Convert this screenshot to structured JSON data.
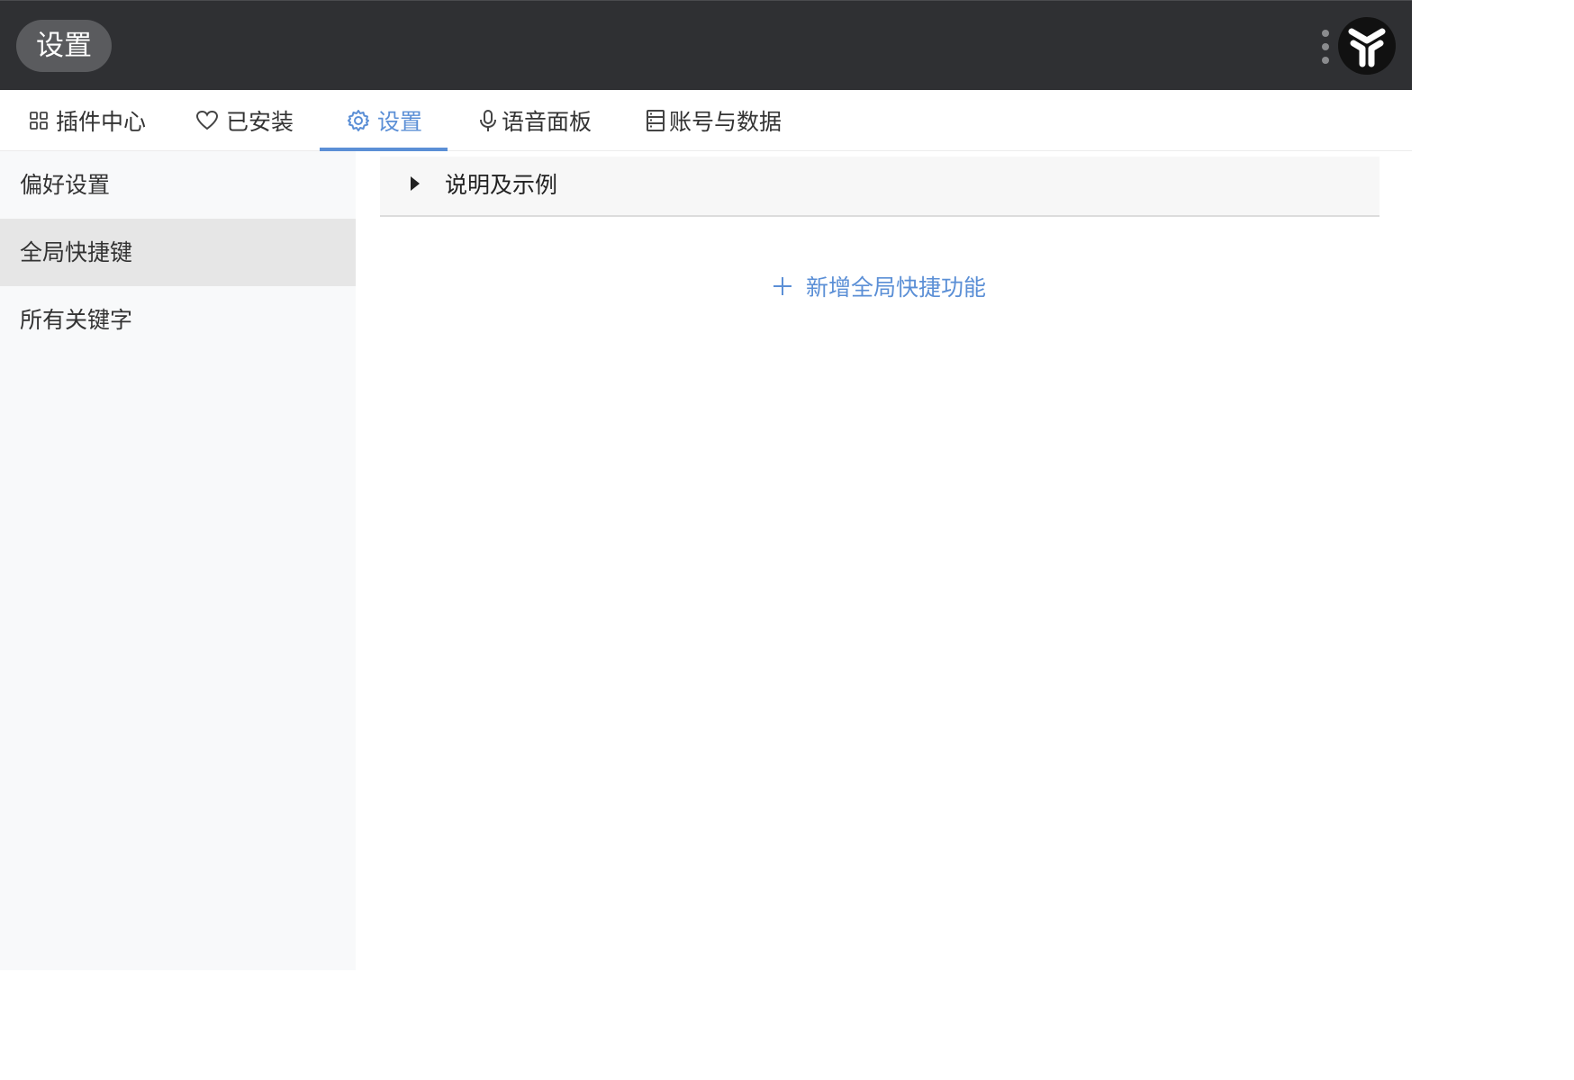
{
  "titlebar": {
    "title": "设置",
    "menu_icon": "more-vertical-icon",
    "logo_icon": "app-logo-icon"
  },
  "tabs": [
    {
      "label": "插件中心",
      "icon": "grid-icon",
      "active": false
    },
    {
      "label": "已安装",
      "icon": "heart-icon",
      "active": false
    },
    {
      "label": "设置",
      "icon": "gear-icon",
      "active": true
    },
    {
      "label": "语音面板",
      "icon": "microphone-icon",
      "active": false
    },
    {
      "label": "账号与数据",
      "icon": "database-icon",
      "active": false
    }
  ],
  "sidebar": {
    "items": [
      {
        "label": "偏好设置",
        "active": false
      },
      {
        "label": "全局快捷键",
        "active": true
      },
      {
        "label": "所有关键字",
        "active": false
      }
    ]
  },
  "main": {
    "expander_label": "说明及示例",
    "add_button_label": "新增全局快捷功能"
  },
  "colors": {
    "accent": "#5b8fd6",
    "titlebar_bg": "#2f3033",
    "sidebar_bg": "#f8f9fa",
    "sidebar_active_bg": "#e6e6e6"
  }
}
